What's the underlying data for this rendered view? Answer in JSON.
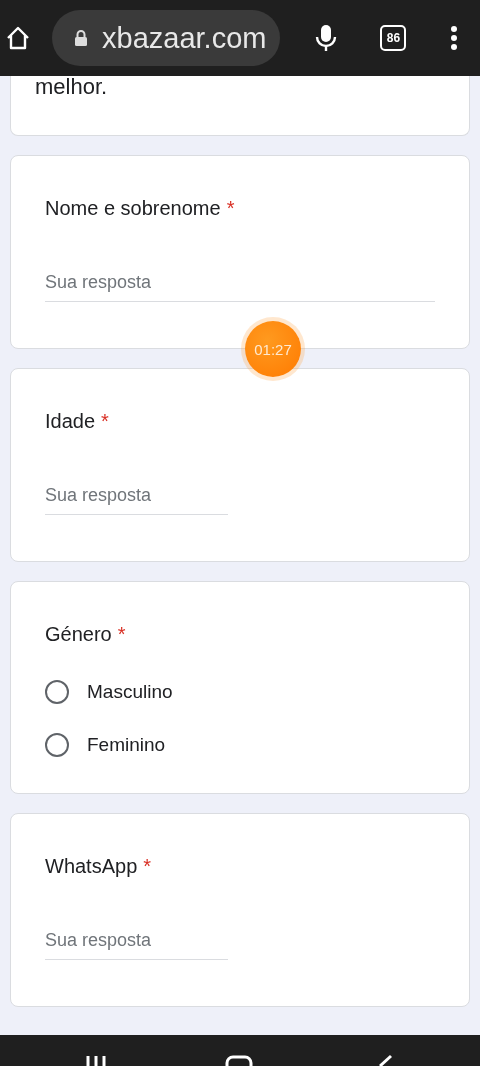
{
  "browser": {
    "url": "xbazaar.com",
    "tab_count": "86"
  },
  "intro": {
    "text_tail": "melhor."
  },
  "questions": [
    {
      "kind": "answer",
      "title": "Nome e sobrenome",
      "required": true,
      "placeholder": "Sua resposta",
      "wide": true
    },
    {
      "kind": "answer",
      "title": "Idade",
      "required": true,
      "placeholder": "Sua resposta",
      "wide": false
    },
    {
      "kind": "choice",
      "title": "Género",
      "required": true,
      "options": [
        {
          "label": "Masculino",
          "selected": false
        },
        {
          "label": "Feminino",
          "selected": false
        }
      ]
    },
    {
      "kind": "answer",
      "title": "WhatsApp",
      "required": true,
      "placeholder": "Sua resposta",
      "wide": false
    }
  ],
  "timer": "01:27",
  "required_mark": "*"
}
